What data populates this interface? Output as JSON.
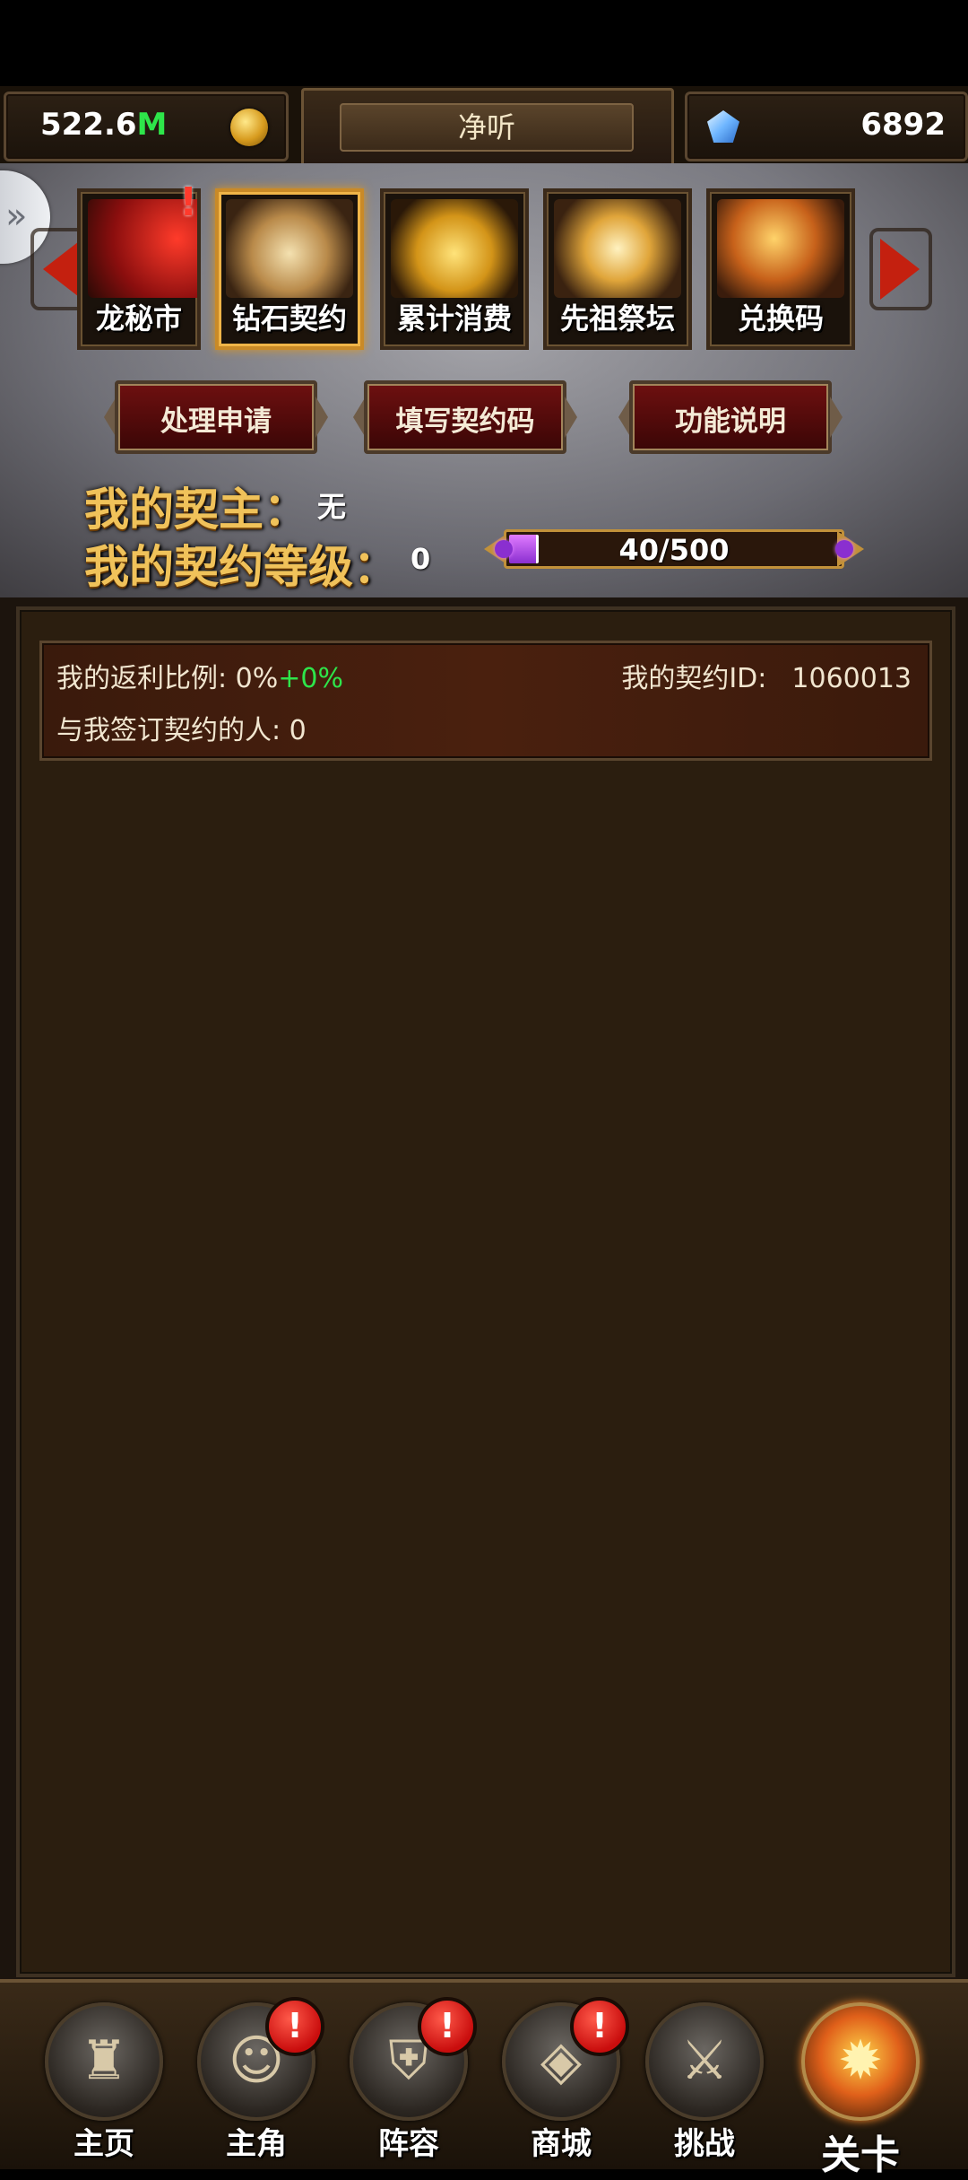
{
  "resources": {
    "gold_number": "522.6",
    "gold_unit": "M",
    "gem_value": "6892",
    "mute_label": "净听"
  },
  "categories": [
    {
      "label": "龙秘市",
      "icon": "dragon-market-icon",
      "alert": "!"
    },
    {
      "label": "钻石契约",
      "icon": "contract-book-icon",
      "selected": true
    },
    {
      "label": "累计消费",
      "icon": "gold-coins-icon"
    },
    {
      "label": "先祖祭坛",
      "icon": "ancestor-altar-icon"
    },
    {
      "label": "兑换码",
      "icon": "redeem-code-icon"
    }
  ],
  "actions": {
    "process_requests": "处理申请",
    "fill_code": "填写契约码",
    "help": "功能说明"
  },
  "contract": {
    "master_label": "我的契主：",
    "master_value": "无",
    "level_label": "我的契约等级：",
    "level_value": "0",
    "progress_text": "40/500",
    "progress_current": 40,
    "progress_max": 500
  },
  "info": {
    "rebate_label": "我的返利比例: 0%",
    "rebate_bonus": "+0%",
    "contract_id_label": "我的契约ID:",
    "contract_id_value": "1060013",
    "signed_count_label": "与我签订契约的人: 0"
  },
  "nav": [
    {
      "label": "主页",
      "icon": "castle-icon"
    },
    {
      "label": "主角",
      "icon": "hero-portrait-icon",
      "badge": "!"
    },
    {
      "label": "阵容",
      "icon": "helmet-icon",
      "badge": "!"
    },
    {
      "label": "商城",
      "icon": "treasure-chest-icon",
      "badge": "!"
    },
    {
      "label": "挑战",
      "icon": "crossed-axes-icon"
    },
    {
      "label": "关卡",
      "icon": "flaming-portal-icon"
    }
  ],
  "colors": {
    "gold_text": "#f0c25a",
    "accent_green": "#2ee54a",
    "badge_red": "#c90d0d",
    "progress_purple": "#8a2fd0"
  }
}
